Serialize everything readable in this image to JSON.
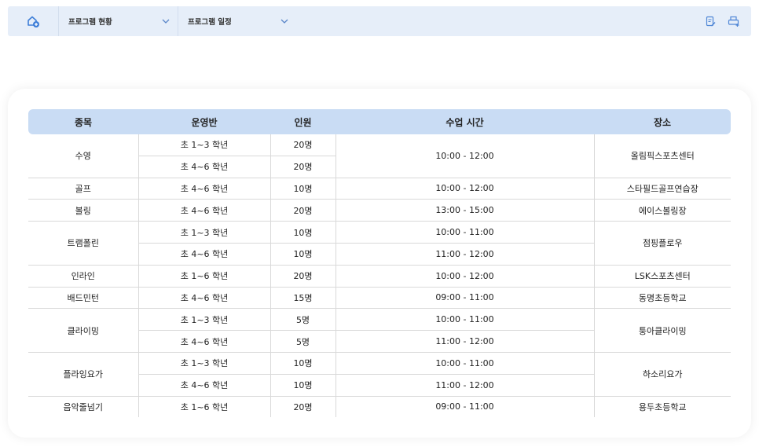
{
  "topbar": {
    "icons": {
      "home": "home-icon",
      "edit": "edit-document-icon",
      "print": "print-icon"
    },
    "crumb1": "프로그램 현황",
    "crumb2": "프로그램 일정"
  },
  "table": {
    "headers": [
      "종목",
      "운영반",
      "인원",
      "수업 시간",
      "장소"
    ],
    "rows": [
      {
        "sport": "수영",
        "classes": [
          {
            "grade": "초 1~3 학년",
            "people": "20명"
          },
          {
            "grade": "초 4~6 학년",
            "people": "20명"
          }
        ],
        "times": [
          "10:00 - 12:00"
        ],
        "place": "올림픽스포츠센터"
      },
      {
        "sport": "골프",
        "classes": [
          {
            "grade": "초 4~6 학년",
            "people": "10명"
          }
        ],
        "times": [
          "10:00 - 12:00"
        ],
        "place": "스타필드골프연습장"
      },
      {
        "sport": "볼링",
        "classes": [
          {
            "grade": "초 4~6 학년",
            "people": "20명"
          }
        ],
        "times": [
          "13:00 - 15:00"
        ],
        "place": "에이스볼링장"
      },
      {
        "sport": "트램폴린",
        "classes": [
          {
            "grade": "초 1~3 학년",
            "people": "10명"
          },
          {
            "grade": "초 4~6 학년",
            "people": "10명"
          }
        ],
        "times": [
          "10:00 - 11:00",
          "11:00 - 12:00"
        ],
        "place": "점핑플로우"
      },
      {
        "sport": "인라인",
        "classes": [
          {
            "grade": "초 1~6 학년",
            "people": "20명"
          }
        ],
        "times": [
          "10:00 - 12:00"
        ],
        "place": "LSK스포츠센터"
      },
      {
        "sport": "배드민턴",
        "classes": [
          {
            "grade": "초 4~6 학년",
            "people": "15명"
          }
        ],
        "times": [
          "09:00 - 11:00"
        ],
        "place": "동명초등학교"
      },
      {
        "sport": "클라이밍",
        "classes": [
          {
            "grade": "초 1~3 학년",
            "people": "5명"
          },
          {
            "grade": "초 4~6 학년",
            "people": "5명"
          }
        ],
        "times": [
          "10:00 - 11:00",
          "11:00 - 12:00"
        ],
        "place": "퉁아클라이밍"
      },
      {
        "sport": "플라잉요가",
        "classes": [
          {
            "grade": "초 1~3 학년",
            "people": "10명"
          },
          {
            "grade": "초 4~6 학년",
            "people": "10명"
          }
        ],
        "times": [
          "10:00 - 11:00",
          "11:00 - 12:00"
        ],
        "place": "하소리요가"
      },
      {
        "sport": "음악줄넘기",
        "classes": [
          {
            "grade": "초 1~6 학년",
            "people": "20명"
          }
        ],
        "times": [
          "09:00 - 11:00"
        ],
        "place": "용두초등학교"
      }
    ]
  },
  "colors": {
    "accent": "#3f7fd8",
    "header_bg": "#c9dcf4",
    "topbar_bg": "#e6eef9"
  }
}
